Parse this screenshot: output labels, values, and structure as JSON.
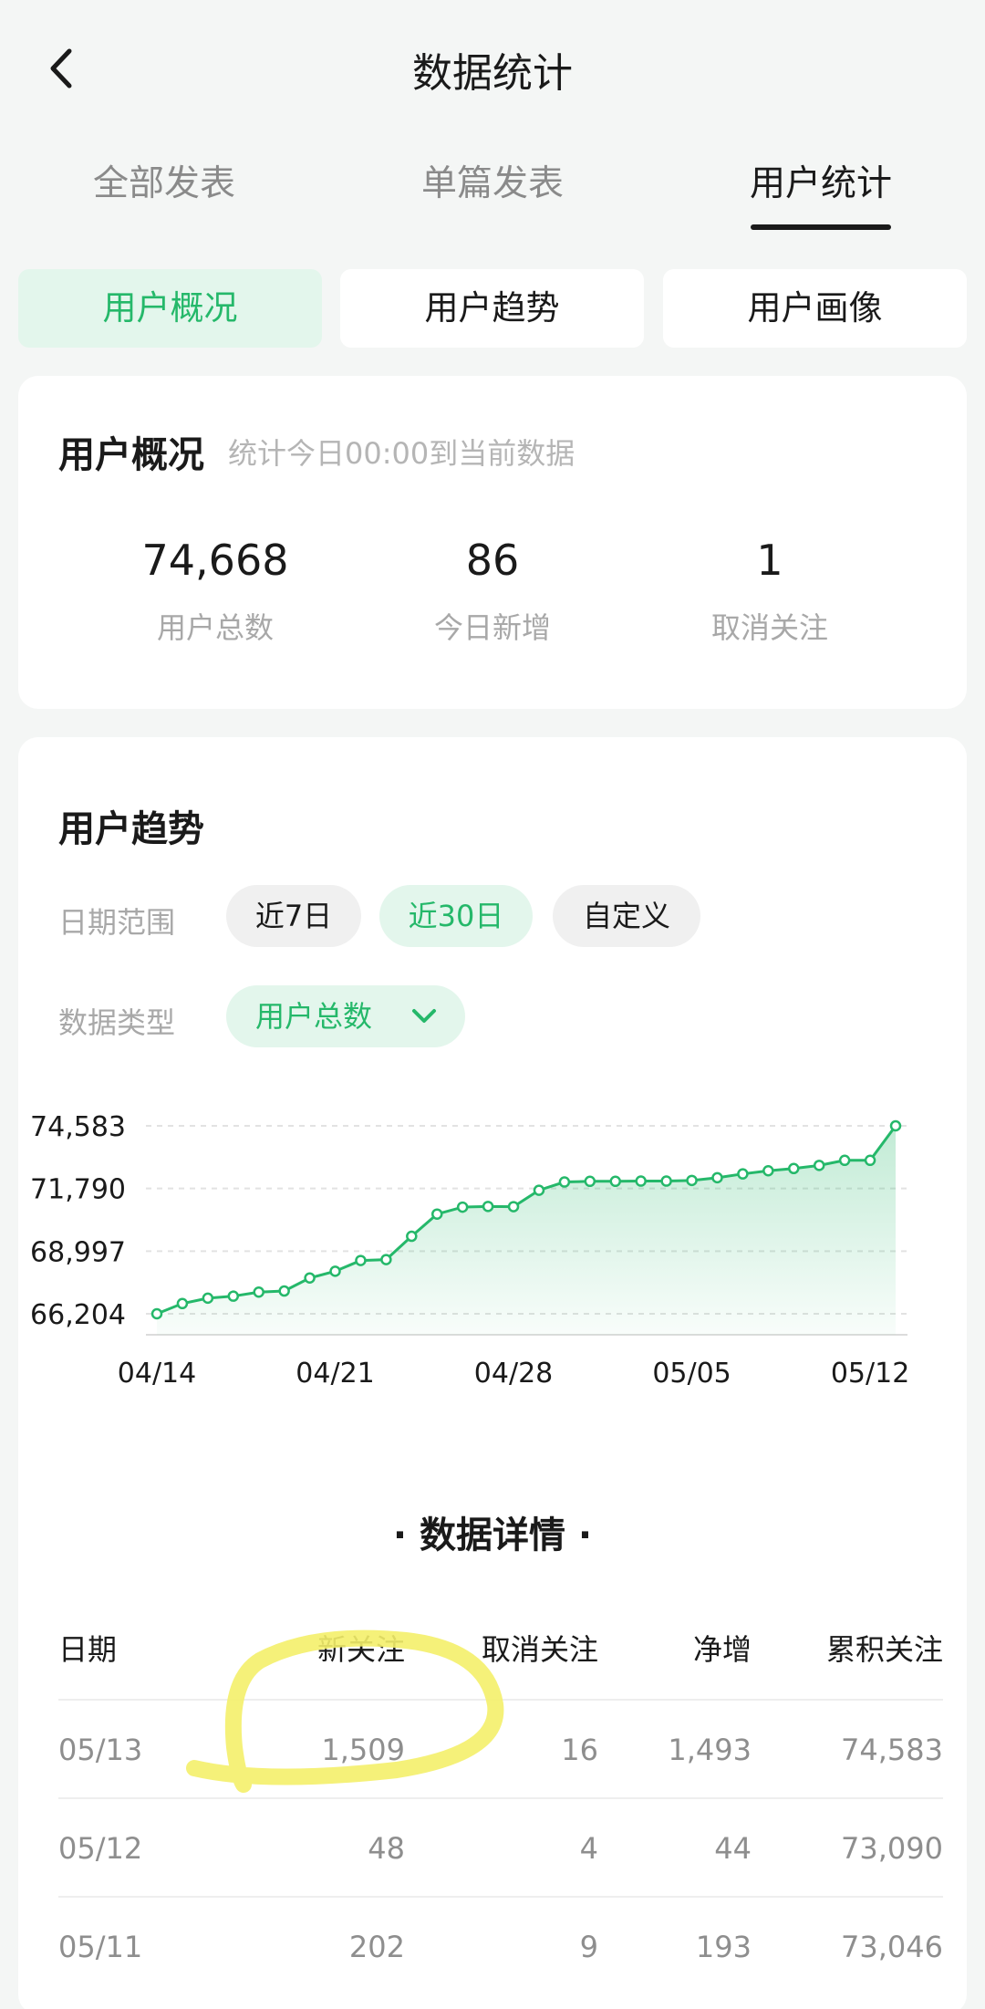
{
  "header": {
    "title": "数据统计"
  },
  "tabs": [
    {
      "label": "全部发表",
      "active": false
    },
    {
      "label": "单篇发表",
      "active": false
    },
    {
      "label": "用户统计",
      "active": true
    }
  ],
  "segments": [
    {
      "label": "用户概况",
      "active": true
    },
    {
      "label": "用户趋势",
      "active": false
    },
    {
      "label": "用户画像",
      "active": false
    }
  ],
  "overview": {
    "title": "用户概况",
    "subtitle": "统计今日00:00到当前数据",
    "stats": [
      {
        "value": "74,668",
        "label": "用户总数"
      },
      {
        "value": "86",
        "label": "今日新增"
      },
      {
        "value": "1",
        "label": "取消关注"
      }
    ]
  },
  "trend": {
    "title": "用户趋势",
    "date_range_label": "日期范围",
    "date_range_options": [
      {
        "label": "近7日",
        "active": false
      },
      {
        "label": "近30日",
        "active": true
      },
      {
        "label": "自定义",
        "active": false
      }
    ],
    "data_type_label": "数据类型",
    "data_type_value": "用户总数",
    "accent_color": "#25b86a"
  },
  "chart_data": {
    "type": "area",
    "title": "",
    "xlabel": "",
    "ylabel": "",
    "x_ticks": [
      "04/14",
      "04/21",
      "04/28",
      "05/05",
      "05/12"
    ],
    "y_ticks": [
      66204,
      68997,
      71790,
      74583
    ],
    "y_tick_labels": [
      "66,204",
      "68,997",
      "71,790",
      "74,583"
    ],
    "ylim": [
      66204,
      74583
    ],
    "grid": true,
    "series": [
      {
        "x": [
          "04/14",
          "04/15",
          "04/16",
          "04/17",
          "04/18",
          "04/19",
          "04/20",
          "04/21",
          "04/22",
          "04/23",
          "04/24",
          "04/25",
          "04/26",
          "04/27",
          "04/28",
          "04/29",
          "04/30",
          "05/01",
          "05/02",
          "05/03",
          "05/04",
          "05/05",
          "05/06",
          "05/07",
          "05/08",
          "05/09",
          "05/10",
          "05/11",
          "05/12",
          "05/13"
        ],
        "values": [
          66204,
          66660,
          66900,
          66990,
          67170,
          67220,
          67800,
          68100,
          68580,
          68620,
          69660,
          70650,
          70960,
          70990,
          70980,
          71710,
          72080,
          72110,
          72110,
          72120,
          72120,
          72150,
          72270,
          72440,
          72580,
          72680,
          72820,
          73046,
          73046,
          74583
        ]
      }
    ]
  },
  "details": {
    "title": "· 数据详情 ·",
    "columns": [
      "日期",
      "新关注",
      "取消关注",
      "净增",
      "累积关注"
    ],
    "rows": [
      [
        "05/13",
        "1,509",
        "16",
        "1,493",
        "74,583"
      ],
      [
        "05/12",
        "48",
        "4",
        "44",
        "73,090"
      ],
      [
        "05/11",
        "202",
        "9",
        "193",
        "73,046"
      ]
    ]
  }
}
